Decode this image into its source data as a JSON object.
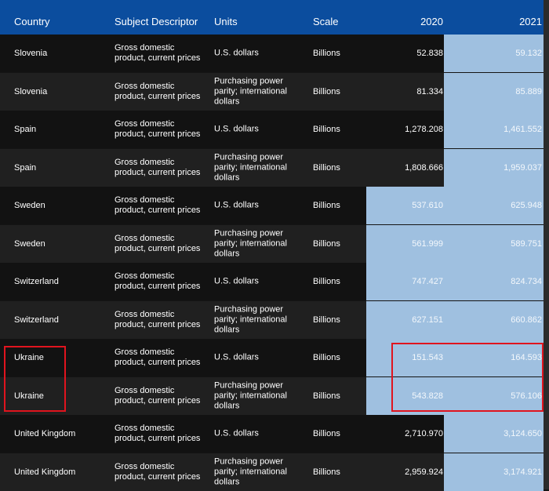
{
  "table": {
    "columns": [
      "Country",
      "Subject Descriptor",
      "Units",
      "Scale",
      "2020",
      "2021"
    ],
    "rows": [
      {
        "country": "Slovenia",
        "subject": "Gross domestic product, current prices",
        "units": "U.S. dollars",
        "scale": "Billions",
        "y2020": "52.838",
        "y2021": "59.132"
      },
      {
        "country": "Slovenia",
        "subject": "Gross domestic product, current prices",
        "units": "Purchasing power parity; international dollars",
        "scale": "Billions",
        "y2020": "81.334",
        "y2021": "85.889"
      },
      {
        "country": "Spain",
        "subject": "Gross domestic product, current prices",
        "units": "U.S. dollars",
        "scale": "Billions",
        "y2020": "1,278.208",
        "y2021": "1,461.552"
      },
      {
        "country": "Spain",
        "subject": "Gross domestic product, current prices",
        "units": "Purchasing power parity; international dollars",
        "scale": "Billions",
        "y2020": "1,808.666",
        "y2021": "1,959.037"
      },
      {
        "country": "Sweden",
        "subject": "Gross domestic product, current prices",
        "units": "U.S. dollars",
        "scale": "Billions",
        "y2020": "537.610",
        "y2021": "625.948"
      },
      {
        "country": "Sweden",
        "subject": "Gross domestic product, current prices",
        "units": "Purchasing power parity; international dollars",
        "scale": "Billions",
        "y2020": "561.999",
        "y2021": "589.751"
      },
      {
        "country": "Switzerland",
        "subject": "Gross domestic product, current prices",
        "units": "U.S. dollars",
        "scale": "Billions",
        "y2020": "747.427",
        "y2021": "824.734"
      },
      {
        "country": "Switzerland",
        "subject": "Gross domestic product, current prices",
        "units": "Purchasing power parity; international dollars",
        "scale": "Billions",
        "y2020": "627.151",
        "y2021": "660.862"
      },
      {
        "country": "Ukraine",
        "subject": "Gross domestic product, current prices",
        "units": "U.S. dollars",
        "scale": "Billions",
        "y2020": "151.543",
        "y2021": "164.593"
      },
      {
        "country": "Ukraine",
        "subject": "Gross domestic product, current prices",
        "units": "Purchasing power parity; international dollars",
        "scale": "Billions",
        "y2020": "543.828",
        "y2021": "576.106"
      },
      {
        "country": "United Kingdom",
        "subject": "Gross domestic product, current prices",
        "units": "U.S. dollars",
        "scale": "Billions",
        "y2020": "2,710.970",
        "y2021": "3,124.650"
      },
      {
        "country": "United Kingdom",
        "subject": "Gross domestic product, current prices",
        "units": "Purchasing power parity; international dollars",
        "scale": "Billions",
        "y2020": "2,959.924",
        "y2021": "3,174.921"
      }
    ]
  },
  "colors": {
    "header": "#0b4d9e",
    "highlight": "#9fc0e0",
    "annotation": "#e0141e"
  }
}
